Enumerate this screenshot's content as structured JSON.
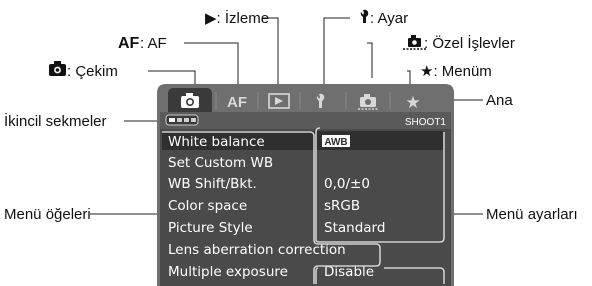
{
  "callouts": {
    "playback": "▶: İzleme",
    "af_prefix": "AF",
    "af_suffix": ": AF",
    "setup": ": Ayar",
    "custom": ": Özel İşlevler",
    "shooting": ": Çekim",
    "mymenu": "★: Menüm",
    "main": "Ana",
    "secondary_tabs": "İkincil sekmeler",
    "menu_items": "Menü öğeleri",
    "menu_settings": "Menü ayarları"
  },
  "screen": {
    "tabs": [
      {
        "icon": "camera-icon",
        "label": ""
      },
      {
        "icon": "af-text-icon",
        "label": "AF"
      },
      {
        "icon": "playback-icon",
        "label": ""
      },
      {
        "icon": "wrench-icon",
        "label": ""
      },
      {
        "icon": "custom-camera-icon",
        "label": ""
      },
      {
        "icon": "star-icon",
        "label": "★"
      }
    ],
    "tab_id": "SHOOT1",
    "items": [
      {
        "name": "White balance",
        "value": "AWB"
      },
      {
        "name": "Set Custom WB",
        "value": ""
      },
      {
        "name": "WB Shift/Bkt.",
        "value": "0,0/±0"
      },
      {
        "name": "Color space",
        "value": "sRGB"
      },
      {
        "name": "Picture Style",
        "value": "Standard"
      },
      {
        "name": "Lens aberration correction",
        "value": ""
      },
      {
        "name": "Multiple exposure",
        "value": "Disable"
      }
    ],
    "colors": {
      "bezel": "#6f6f6f",
      "screen": "#4a4a4a",
      "selected_tab": "#3a3a3a",
      "highlight": "#2f2f2f",
      "divider": "#9a9a9a"
    }
  }
}
